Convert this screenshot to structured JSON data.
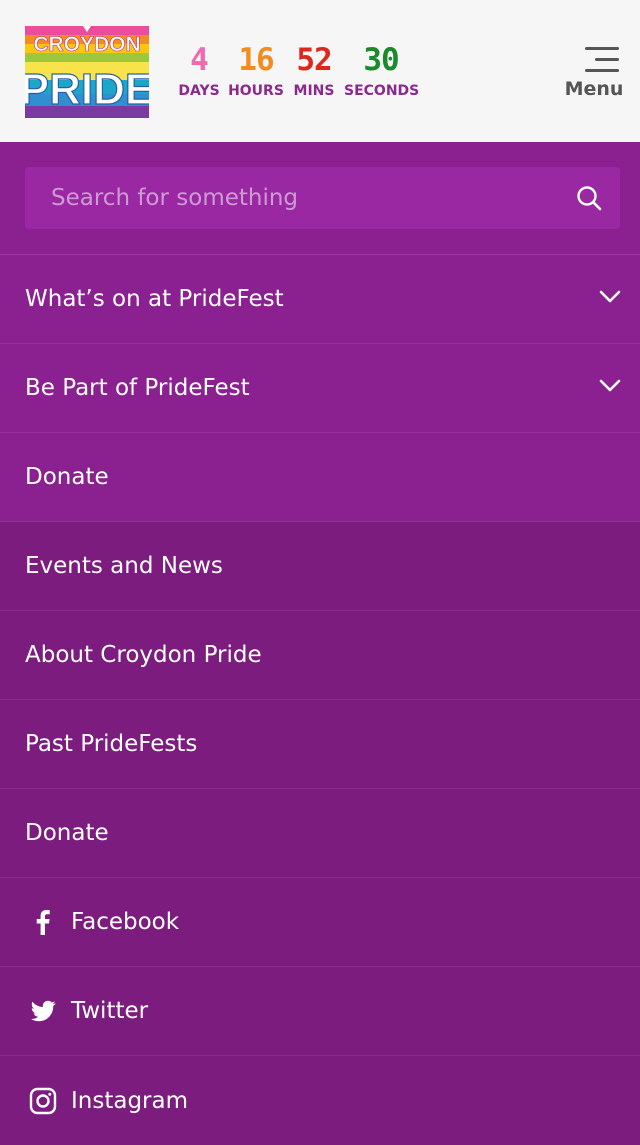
{
  "header": {
    "logo_text_top": "CROYDON",
    "logo_text_bottom": "PRIDE",
    "countdown": [
      {
        "value": "4",
        "label": "DAYS",
        "color": "#f06ab0"
      },
      {
        "value": "16",
        "label": "HOURS",
        "color": "#f28c1e"
      },
      {
        "value": "52",
        "label": "MINS",
        "color": "#e0261c"
      },
      {
        "value": "30",
        "label": "SECONDS",
        "color": "#1a8a2a"
      }
    ],
    "menu_label": "Menu"
  },
  "search": {
    "placeholder": "Search for something"
  },
  "primary_items": [
    {
      "label": "What’s on at PrideFest",
      "has_chevron": true
    },
    {
      "label": "Be Part of PrideFest",
      "has_chevron": true
    },
    {
      "label": "Donate",
      "has_chevron": false
    }
  ],
  "secondary_items": [
    {
      "label": "Events and News"
    },
    {
      "label": "About Croydon Pride"
    },
    {
      "label": "Past PrideFests"
    },
    {
      "label": "Donate"
    }
  ],
  "social": [
    {
      "label": "Facebook",
      "icon": "facebook-icon"
    },
    {
      "label": "Twitter",
      "icon": "twitter-icon"
    },
    {
      "label": "Instagram",
      "icon": "instagram-icon"
    }
  ],
  "colors": {
    "header_bg": "#f6f6f6",
    "nav_primary": "#8b2190",
    "nav_secondary": "#7b1c7e",
    "label_purple": "#8a2a8c"
  }
}
